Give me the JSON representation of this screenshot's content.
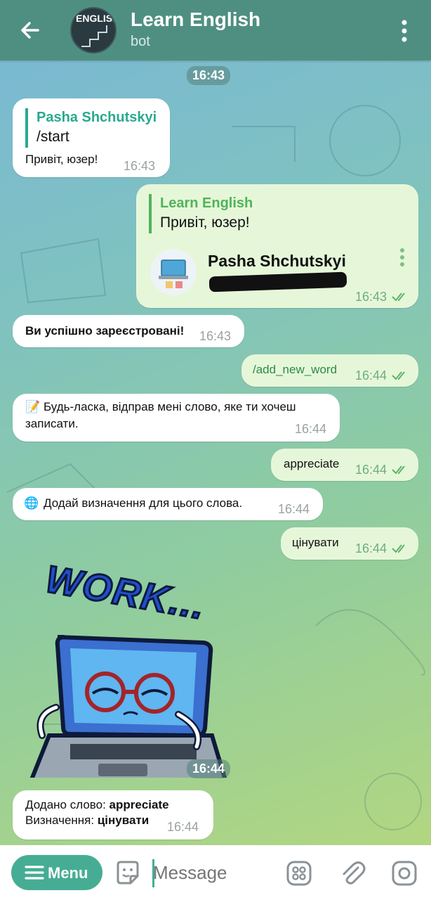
{
  "header": {
    "title": "Learn English",
    "subtitle": "bot",
    "avatar_text": "ENGLISH"
  },
  "chat": {
    "top_time": "16:43",
    "messages": [
      {
        "dir": "in",
        "quote_name": "Pasha Shchutskyi",
        "quote_text": "/start",
        "text": "Привіт, юзер!",
        "time": "16:43"
      },
      {
        "dir": "out",
        "quote_name": "Learn English",
        "quote_text": "Привіт, юзер!",
        "contact_name": "Pasha Shchutskyi",
        "time": "16:43"
      },
      {
        "dir": "in",
        "text": "Ви успішно зареєстровані!",
        "time": "16:43"
      },
      {
        "dir": "out",
        "text": "/add_new_word",
        "time": "16:44"
      },
      {
        "dir": "in",
        "emoji": "📝",
        "text_line1": "Будь-ласка, відправ мені слово, яке ти хочеш",
        "text_line2": "записати.",
        "time": "16:44"
      },
      {
        "dir": "out",
        "text": "appreciate",
        "time": "16:44"
      },
      {
        "dir": "in",
        "emoji": "🌐",
        "text": "Додай визначення для цього слова.",
        "time": "16:44"
      },
      {
        "dir": "out",
        "text": "цінувати",
        "time": "16:44"
      },
      {
        "dir": "in",
        "sticker_text": "WORK...",
        "time": "16:44"
      },
      {
        "dir": "in",
        "line1_label": "Додано слово: ",
        "line1_value": "appreciate",
        "line2_label": "Визначення: ",
        "line2_value": "цінувати",
        "time": "16:44"
      }
    ]
  },
  "composer": {
    "menu_label": "Menu",
    "placeholder": "Message"
  },
  "colors": {
    "header": "#4f8f82",
    "accent": "#46ad94",
    "outgoing_bubble": "#e6f7d9",
    "incoming_bubble": "#ffffff"
  },
  "icons": [
    "back-arrow-icon",
    "more-vert-icon",
    "sticker-icon",
    "apps-icon",
    "attach-icon",
    "camera-icon",
    "double-check-icon"
  ]
}
